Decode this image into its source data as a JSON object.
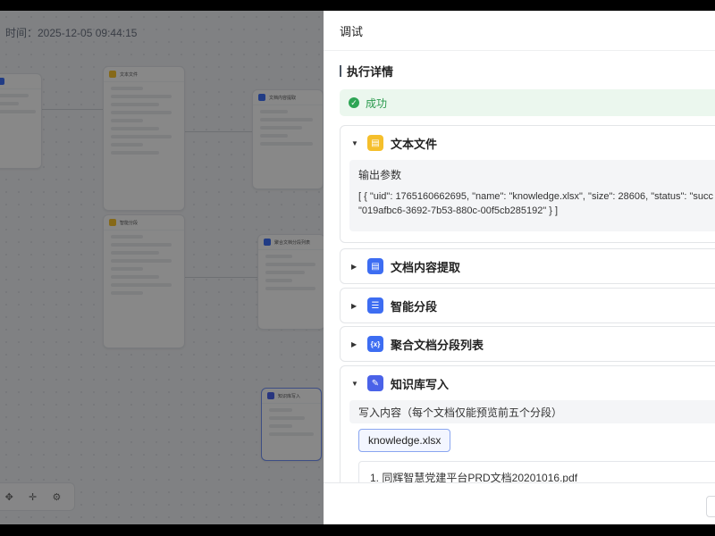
{
  "canvas": {
    "run_time": "时间：2025-12-05 09:44:15",
    "node_titles": [
      "文本文件",
      "文档内容提取",
      "智能分段",
      "聚合文档分段列表",
      "知识库写入"
    ]
  },
  "panel": {
    "title": "调试",
    "section_title": "执行详情",
    "status": "成功",
    "nodes": [
      {
        "name": "文本文件",
        "icon": "file-icon",
        "expanded": true,
        "output_label": "输出参数",
        "output_line1": "[ { \"uid\": 1765160662695, \"name\": \"knowledge.xlsx\", \"size\": 28606, \"status\": \"succ",
        "output_line2": "\"019afbc6-3692-7b53-880c-00f5cb285192\" } ]"
      },
      {
        "name": "文档内容提取",
        "icon": "document-icon",
        "expanded": false
      },
      {
        "name": "智能分段",
        "icon": "list-icon",
        "expanded": false
      },
      {
        "name": "聚合文档分段列表",
        "icon": "variable-icon",
        "expanded": false
      },
      {
        "name": "知识库写入",
        "icon": "edit-icon",
        "expanded": true,
        "write_label": "写入内容（每个文档仅能预览前五个分段）",
        "file_tag": "knowledge.xlsx",
        "first_item": "1. 同辉智慧党建平台PRD文档20201016.pdf"
      }
    ]
  },
  "colors": {
    "success_bg": "#ebf7ee",
    "success_text": "#2a9a4d",
    "accent_blue": "#3d6df2",
    "file_icon": "#f5bf2c"
  }
}
